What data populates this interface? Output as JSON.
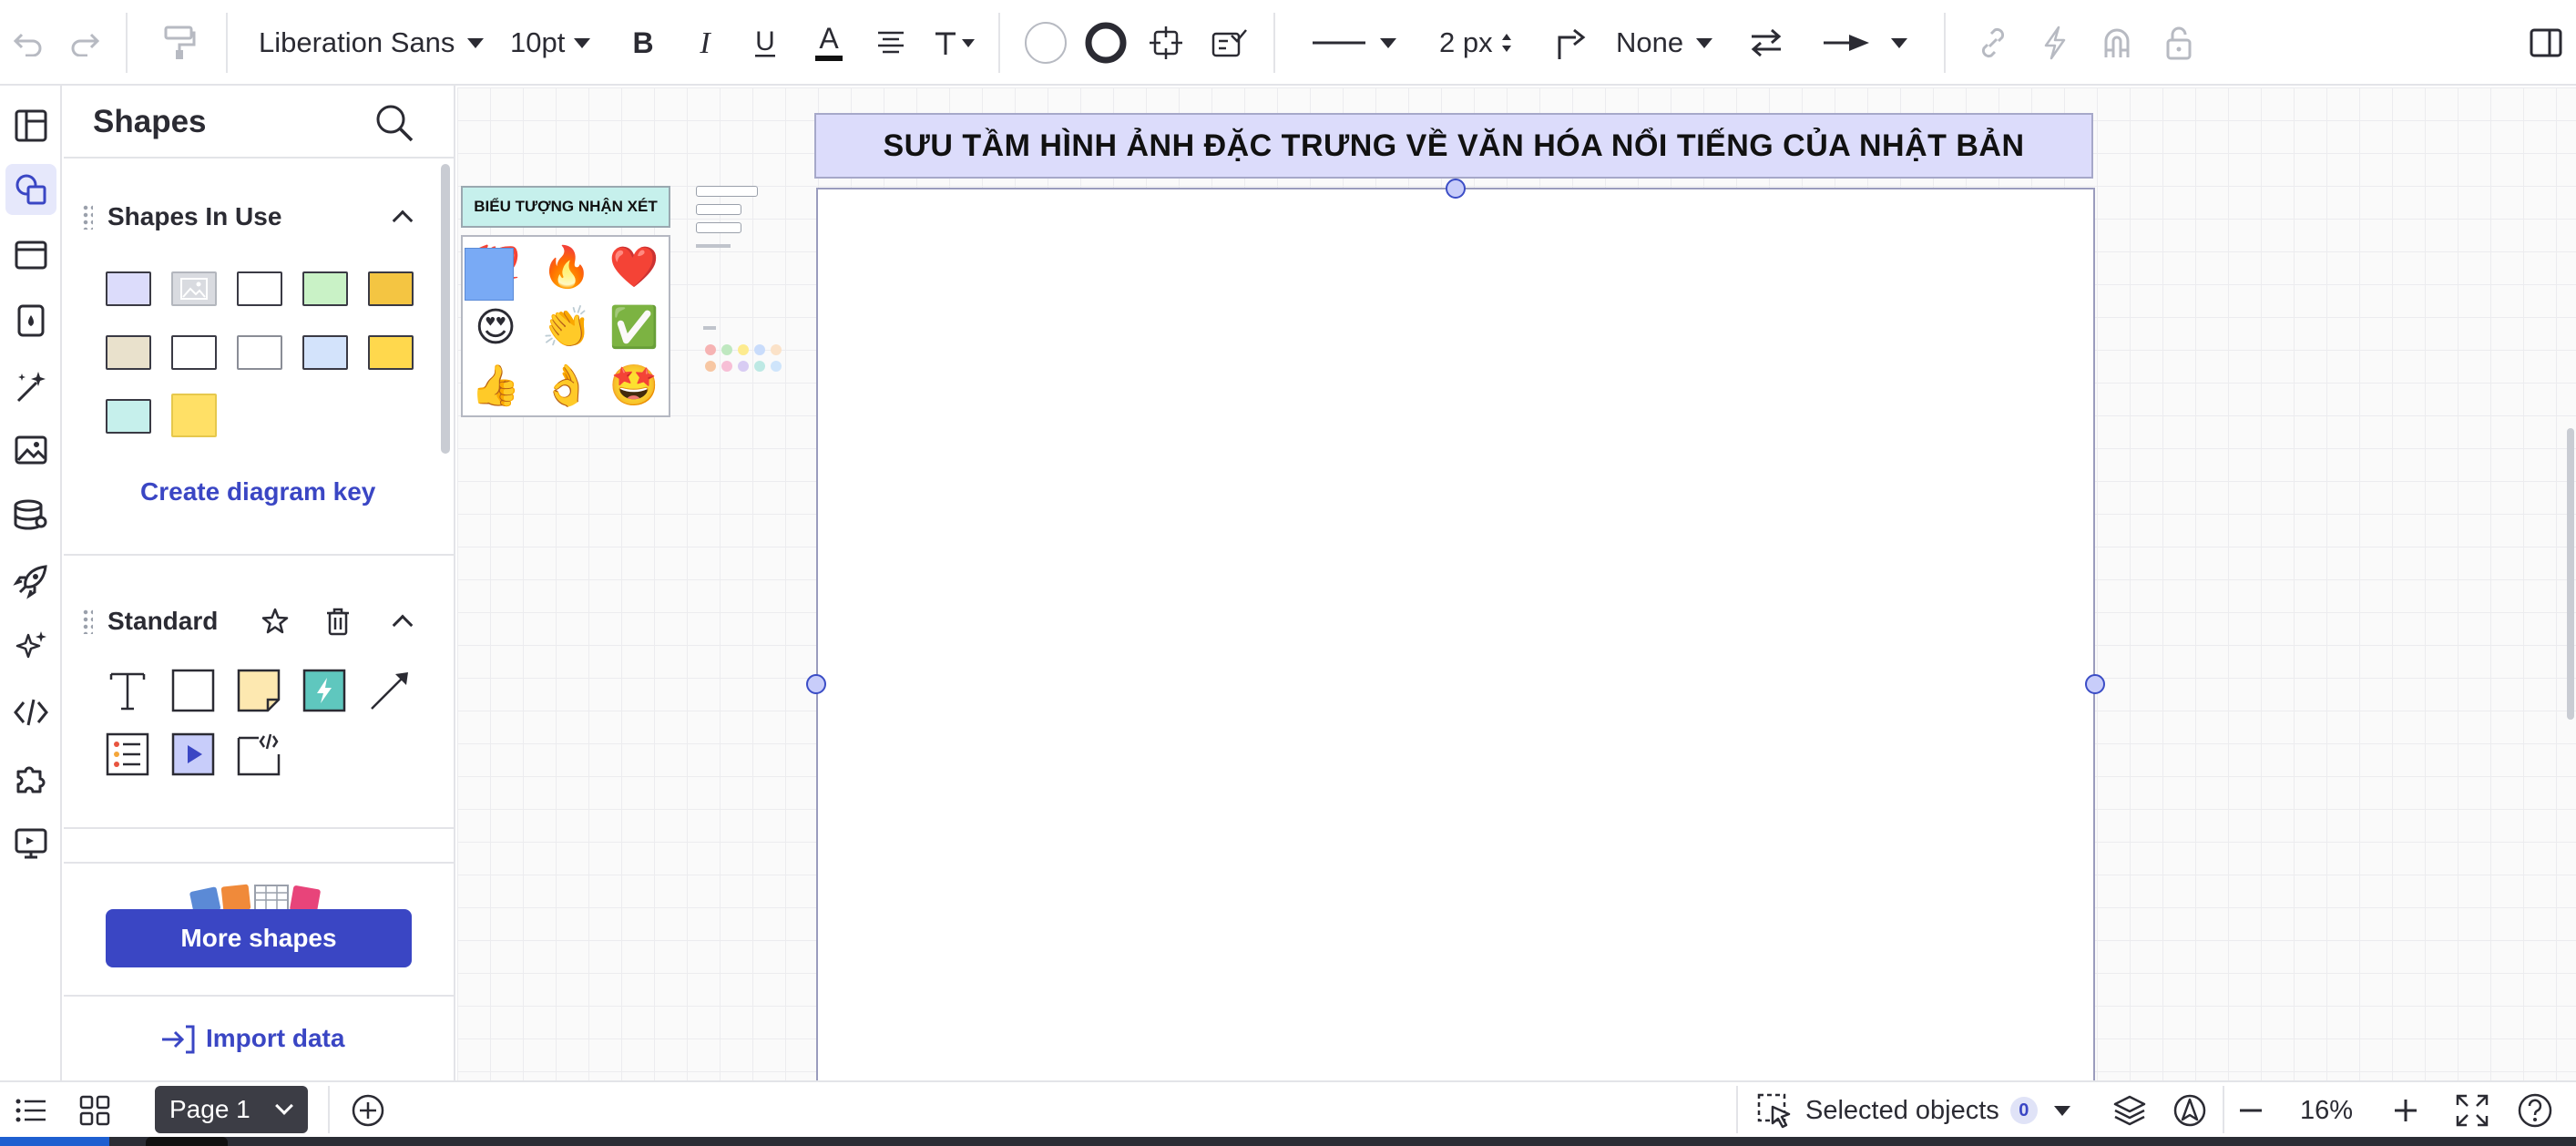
{
  "toolbar": {
    "font_family": "Liberation Sans",
    "font_size": "10pt",
    "line_width": "2 px",
    "line_end": "None"
  },
  "panel": {
    "title": "Shapes",
    "shapes_in_use_title": "Shapes In Use",
    "swatches": [
      "#dcdcfb",
      "image",
      "#ffffff",
      "#c9f2c6",
      "#f4c542",
      "#e9e1cc",
      "#ffffff",
      "#ffffff",
      "#d3e3fb",
      "#ffd84d",
      "#c6f0ec",
      "#ffe066"
    ],
    "create_key_label": "Create diagram key",
    "standard_title": "Standard",
    "more_shapes_label": "More shapes",
    "import_label": "Import data"
  },
  "canvas": {
    "banner_text": "SƯU TẦM HÌNH ẢNH ĐẶC TRƯNG VỀ VĂN HÓA NỔI TIẾNG CỦA NHẬT BẢN",
    "legend_title": "BIỂU TƯỢNG NHẬN XÉT",
    "emojis": [
      "💯",
      "🔥",
      "❤️",
      "😍",
      "👏",
      "✅",
      "👍",
      "👌",
      "🤩"
    ]
  },
  "status": {
    "page_label": "Page 1",
    "selected_label": "Selected objects",
    "selected_count": "0",
    "zoom": "16%"
  },
  "colors": {
    "accent": "#3a46c4",
    "banner_fill": "#dcdcfb",
    "legend_fill": "#c6f0ec",
    "handle": "#3b4dc6"
  }
}
